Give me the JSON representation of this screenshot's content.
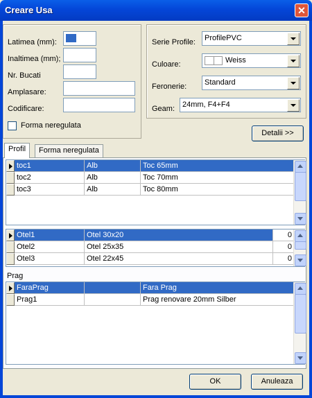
{
  "window": {
    "title": "Creare Usa",
    "close_glyph": "✕"
  },
  "left_group": {
    "labels": {
      "latimea": "Latimea (mm):",
      "inaltimea": "Inaltimea (mm);",
      "nr_bucati": "Nr. Bucati",
      "amplasare": "Amplasare:",
      "codificare": "Codificare:"
    },
    "values": {
      "latimea": "",
      "inaltimea": "",
      "nr_bucati": "",
      "amplasare": "",
      "codificare": ""
    },
    "checkbox_label": "Forma neregulata",
    "checkbox_checked": false
  },
  "right_group": {
    "labels": {
      "serie": "Serie Profile:",
      "culoare": "Culoare:",
      "feronerie": "Feronerie:",
      "geam": "Geam:"
    },
    "values": {
      "serie": "ProfilePVC",
      "culoare": "Weiss",
      "feronerie": "Standard",
      "geam": "24mm, F4+F4"
    },
    "culoare_swatch": "#FFFFFF"
  },
  "detalii_button": "Detalii >>",
  "tabs": [
    {
      "label": "Profil",
      "active": true
    },
    {
      "label": "Forma neregulata",
      "active": false
    }
  ],
  "profil_grid": {
    "rows": [
      {
        "c1": "toc1",
        "c2": "Alb",
        "c3": "Toc 65mm",
        "selected": true
      },
      {
        "c1": "toc2",
        "c2": "Alb",
        "c3": "Toc 70mm",
        "selected": false
      },
      {
        "c1": "toc3",
        "c2": "Alb",
        "c3": "Toc 80mm",
        "selected": false
      }
    ]
  },
  "otel_grid": {
    "rows": [
      {
        "c1": "Otel1",
        "c2": "Otel 30x20",
        "c3": "0",
        "selected": true
      },
      {
        "c1": "Otel2",
        "c2": "Otel 25x35",
        "c3": "0",
        "selected": false
      },
      {
        "c1": "Otel3",
        "c2": "Otel 22x45",
        "c3": "0",
        "selected": false
      }
    ]
  },
  "prag": {
    "label": "Prag",
    "rows": [
      {
        "c1": "FaraPrag",
        "c2": "",
        "c3": "Fara Prag",
        "selected": true
      },
      {
        "c1": "Prag1",
        "c2": "",
        "c3": "Prag renovare 20mm Silber",
        "selected": false
      }
    ]
  },
  "buttons": {
    "ok": "OK",
    "cancel": "Anuleaza"
  },
  "colors": {
    "selection": "#316AC5",
    "title_bar": "#0446D8",
    "dialog_bg": "#ECE9D8"
  }
}
